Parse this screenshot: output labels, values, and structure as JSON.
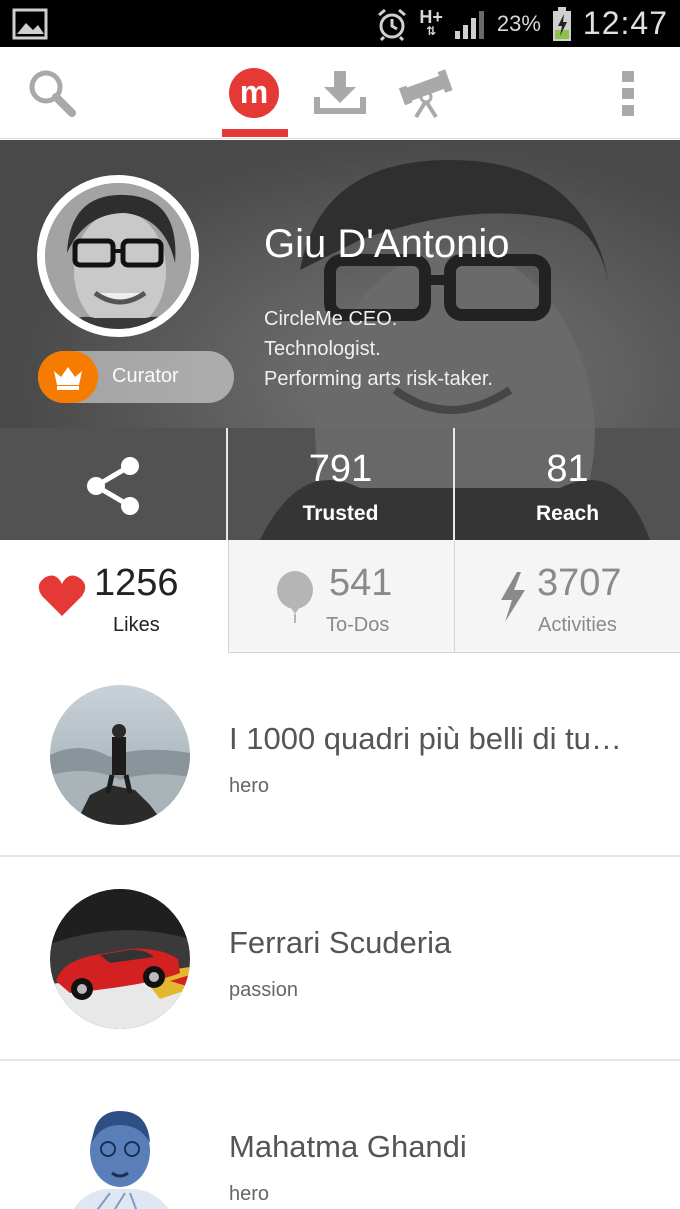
{
  "status_bar": {
    "network": "H+",
    "network_arrows": "⇅",
    "battery_percent": "23%",
    "time": "12:47"
  },
  "action_bar": {
    "icons": [
      "search-icon",
      "circleme-logo-icon",
      "download-icon",
      "telescope-icon",
      "overflow-menu-icon"
    ],
    "logo_letter": "m",
    "accent_color": "#e53935"
  },
  "profile": {
    "name": "Giu D'Antonio",
    "bio": [
      "CircleMe CEO.",
      "Technologist.",
      "Performing arts risk-taker."
    ],
    "badge": {
      "label": "Curator",
      "color": "#f57c00"
    }
  },
  "stats_top": [
    {
      "value": "791",
      "label": "Trusted"
    },
    {
      "value": "81",
      "label": "Reach"
    }
  ],
  "stats_bottom": [
    {
      "value": "1256",
      "label": "Likes",
      "color": "#222222",
      "icon": "heart-icon",
      "icon_color": "#e53935"
    },
    {
      "value": "541",
      "label": "To-Dos",
      "color": "#8a8a8a",
      "icon": "balloon-icon",
      "icon_color": "#b0b0b0"
    },
    {
      "value": "3707",
      "label": "Activities",
      "color": "#8a8a8a",
      "icon": "lightning-icon",
      "icon_color": "#8a8a8a"
    }
  ],
  "list": [
    {
      "title": "I 1000 quadri più belli di tu…",
      "subtitle": "hero"
    },
    {
      "title": "Ferrari Scuderia",
      "subtitle": "passion"
    },
    {
      "title": "Mahatma Ghandi",
      "subtitle": "hero"
    }
  ]
}
